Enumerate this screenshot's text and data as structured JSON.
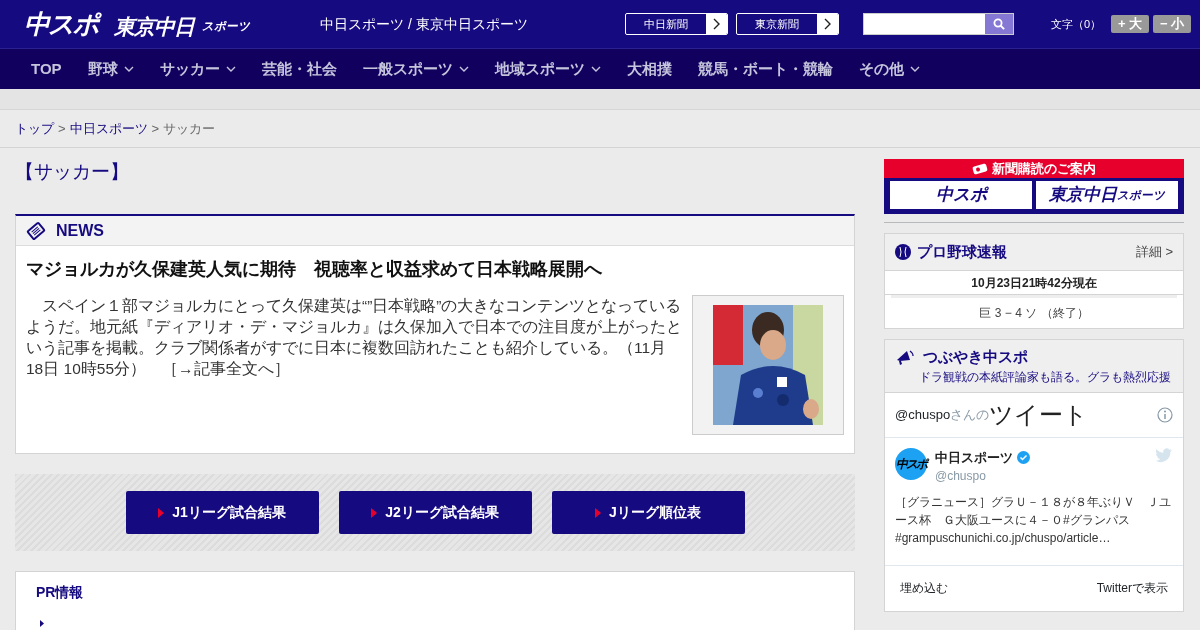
{
  "header": {
    "logo_main": "中スポ",
    "logo_sub": "東京中日",
    "logo_sub_small": "スポーツ",
    "site_title": "中日スポーツ / 東京中日スポーツ",
    "paper_links": [
      "中日新聞",
      "東京新聞"
    ],
    "font_size_label": "文字（0）",
    "font_buttons": [
      {
        "sign": "+",
        "label": "大"
      },
      {
        "sign": "−",
        "label": "小"
      }
    ]
  },
  "nav": [
    {
      "label": "TOP",
      "dropdown": false
    },
    {
      "label": "野球",
      "dropdown": true
    },
    {
      "label": "サッカー",
      "dropdown": true
    },
    {
      "label": "芸能・社会",
      "dropdown": false
    },
    {
      "label": "一般スポーツ",
      "dropdown": true
    },
    {
      "label": "地域スポーツ",
      "dropdown": true
    },
    {
      "label": "大相撲",
      "dropdown": false
    },
    {
      "label": "競馬・ボート・競輪",
      "dropdown": false
    },
    {
      "label": "その他",
      "dropdown": true
    }
  ],
  "breadcrumb": [
    {
      "kind": "link",
      "label": "トップ"
    },
    {
      "kind": "separator",
      "label": ">"
    },
    {
      "kind": "link",
      "label": "中日スポーツ"
    },
    {
      "kind": "separator",
      "label": ">"
    },
    {
      "kind": "current",
      "label": "サッカー"
    }
  ],
  "section_title": "【サッカー】",
  "news": {
    "heading": "NEWS",
    "headline": "マジョルカが久保建英人気に期待　視聴率と収益求めて日本戦略展開へ",
    "body": "　スペイン１部マジョルカにとって久保建英は“”日本戦略”の大きなコンテンツとなっているようだ。地元紙『ディアリオ・デ・マジョルカ』は久保加入で日本での注目度が上がったという記事を掲載。クラブ関係者がすでに日本に複数回訪れたことも紹介している。（11月18日 10時55分）",
    "more_link": "［→記事全文へ］"
  },
  "league_buttons": [
    "J1リーグ試合結果",
    "J2リーグ試合結果",
    "Jリーグ順位表"
  ],
  "pr": {
    "title": "PR情報"
  },
  "sidebar": {
    "subscribe": {
      "banner": "新聞購読のご案内",
      "logos": [
        {
          "main": "中スポ"
        },
        {
          "main": "東京中日",
          "small": "スポーツ"
        }
      ]
    },
    "baseball": {
      "title": "プロ野球速報",
      "detail": "詳細 >",
      "timestamp": "10月23日21時42分現在",
      "games": [
        "巨 3 − 4 ソ （終了）"
      ]
    },
    "tweets": {
      "title": "つぶやき中スポ",
      "subtitle": "ドラ観戦の本紙評論家も語る。グラも熱烈応援",
      "handle_prefix": "@chuspo",
      "handle_suffix": "さんの",
      "heading": "ツイート",
      "author": "中日スポーツ",
      "verified": true,
      "author_handle": "@chuspo",
      "avatar_text": "中スポ",
      "text": [
        {
          "kind": "text",
          "text": "［グラニュース］グラＵ－１８が８年ぶりＶ　Ｊユース杯　Ｇ大阪ユースに４－０"
        },
        {
          "kind": "link",
          "text": "#グランパス"
        },
        {
          "kind": "link",
          "text": "#grampuschunichi.co.jp/chuspo/article…"
        }
      ],
      "embed": "埋め込む",
      "view": "Twitterで表示"
    }
  }
}
